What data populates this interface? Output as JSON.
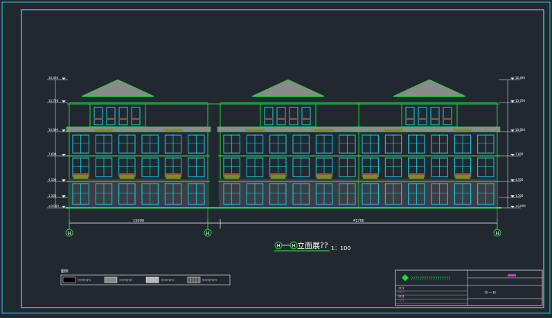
{
  "drawing": {
    "title_prefix": "H",
    "title_suffix": "H",
    "title_text": "立面展??",
    "scale": "1：100",
    "dim_left_total": "15000",
    "dim_right_total": "41700",
    "axis_left": "H",
    "axis_mid": "H",
    "axis_right": "H"
  },
  "legend": {
    "title": "图例：",
    "items": [
      {
        "label": "??????????",
        "swatch": "#000000"
      },
      {
        "label": "??????????",
        "swatch": "#8a8a8a"
      },
      {
        "label": "??????????",
        "swatch": "#b8b8b8"
      },
      {
        "label": "???????????",
        "swatch": "hatch"
      }
    ]
  },
  "title_block": {
    "company": "??????????????????",
    "drawing_no": "H — H",
    "rows": [
      "????",
      "????",
      "????",
      "????"
    ]
  },
  "colors": {
    "background": "#212830",
    "frame": "#19d3e6",
    "building": "#22d83a",
    "window": "#12d7ee",
    "dim": "#ffffff",
    "roof": "#8a8a8a",
    "balcony": "#7a8b2a",
    "brown": "#8a4a3a",
    "magenta": "#e040e0"
  },
  "elevations": {
    "left": [
      "16.490",
      "13.700",
      "10.800",
      "7.600",
      "4.500",
      "1.500",
      "±0.000"
    ],
    "right": [
      "16.490",
      "13.700",
      "10.800",
      "7.600",
      "4.500",
      "1.500",
      "±0.000"
    ]
  }
}
